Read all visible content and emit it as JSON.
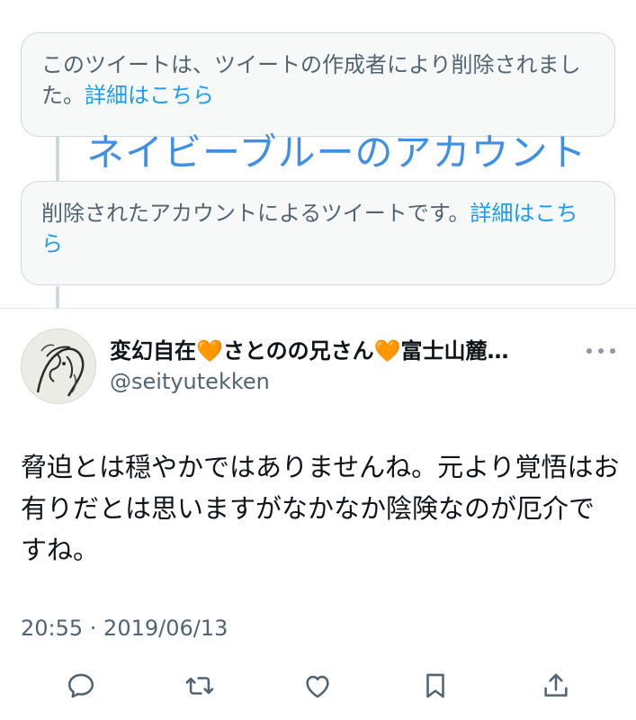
{
  "deleted_tweet_1": {
    "text": "このツイートは、ツイートの作成者により削除されました。",
    "link": "詳細はこちら"
  },
  "overlay_annotation": "ネイビーブルーのアカウント",
  "deleted_tweet_2": {
    "text": "削除されたアカウントによるツイートです。",
    "link": "詳細はこちら"
  },
  "tweet": {
    "author_name": "変幻自在🧡さとのの兄さん🧡富士山麓…",
    "handle": "@seityutekken",
    "body": "脅迫とは穏やかではありませんね。元より覚悟はお有りだとは思いますがなかなか陰険なのが厄介ですね。",
    "timestamp": "20:55 · 2019/06/13"
  },
  "actions": {
    "icons": [
      "reply-icon",
      "retweet-icon",
      "like-icon",
      "bookmark-icon",
      "share-icon"
    ]
  },
  "colors": {
    "accent": "#1d9bf0",
    "overlay": "#3f8fe6",
    "secondary_text": "#536471",
    "icon": "#536471"
  }
}
